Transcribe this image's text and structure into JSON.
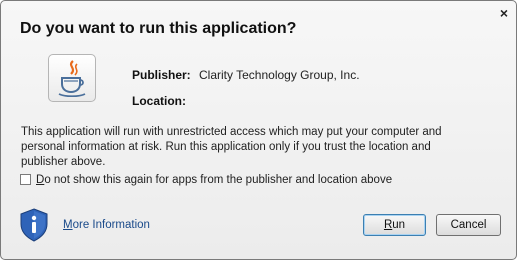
{
  "dialog": {
    "title": "Do you want to run this application?",
    "close_glyph": "×"
  },
  "info": {
    "publisher_label": "Publisher:",
    "publisher_value": "Clarity Technology Group, Inc.",
    "location_label": "Location:",
    "location_value": ""
  },
  "warning": "This application will run with unrestricted access which may put your computer and personal information at risk. Run this application only if you trust the location and publisher above.",
  "checkbox": {
    "label": "Do not show this again for apps from the publisher and location above",
    "checked": false
  },
  "footer": {
    "more_info": "More Information",
    "run_label": "Run",
    "cancel_label": "Cancel"
  },
  "icons": {
    "app": "java-icon",
    "info": "info-shield-icon",
    "close": "close-icon"
  },
  "colors": {
    "link": "#1a4a8a",
    "shield": "#2f63b8"
  }
}
